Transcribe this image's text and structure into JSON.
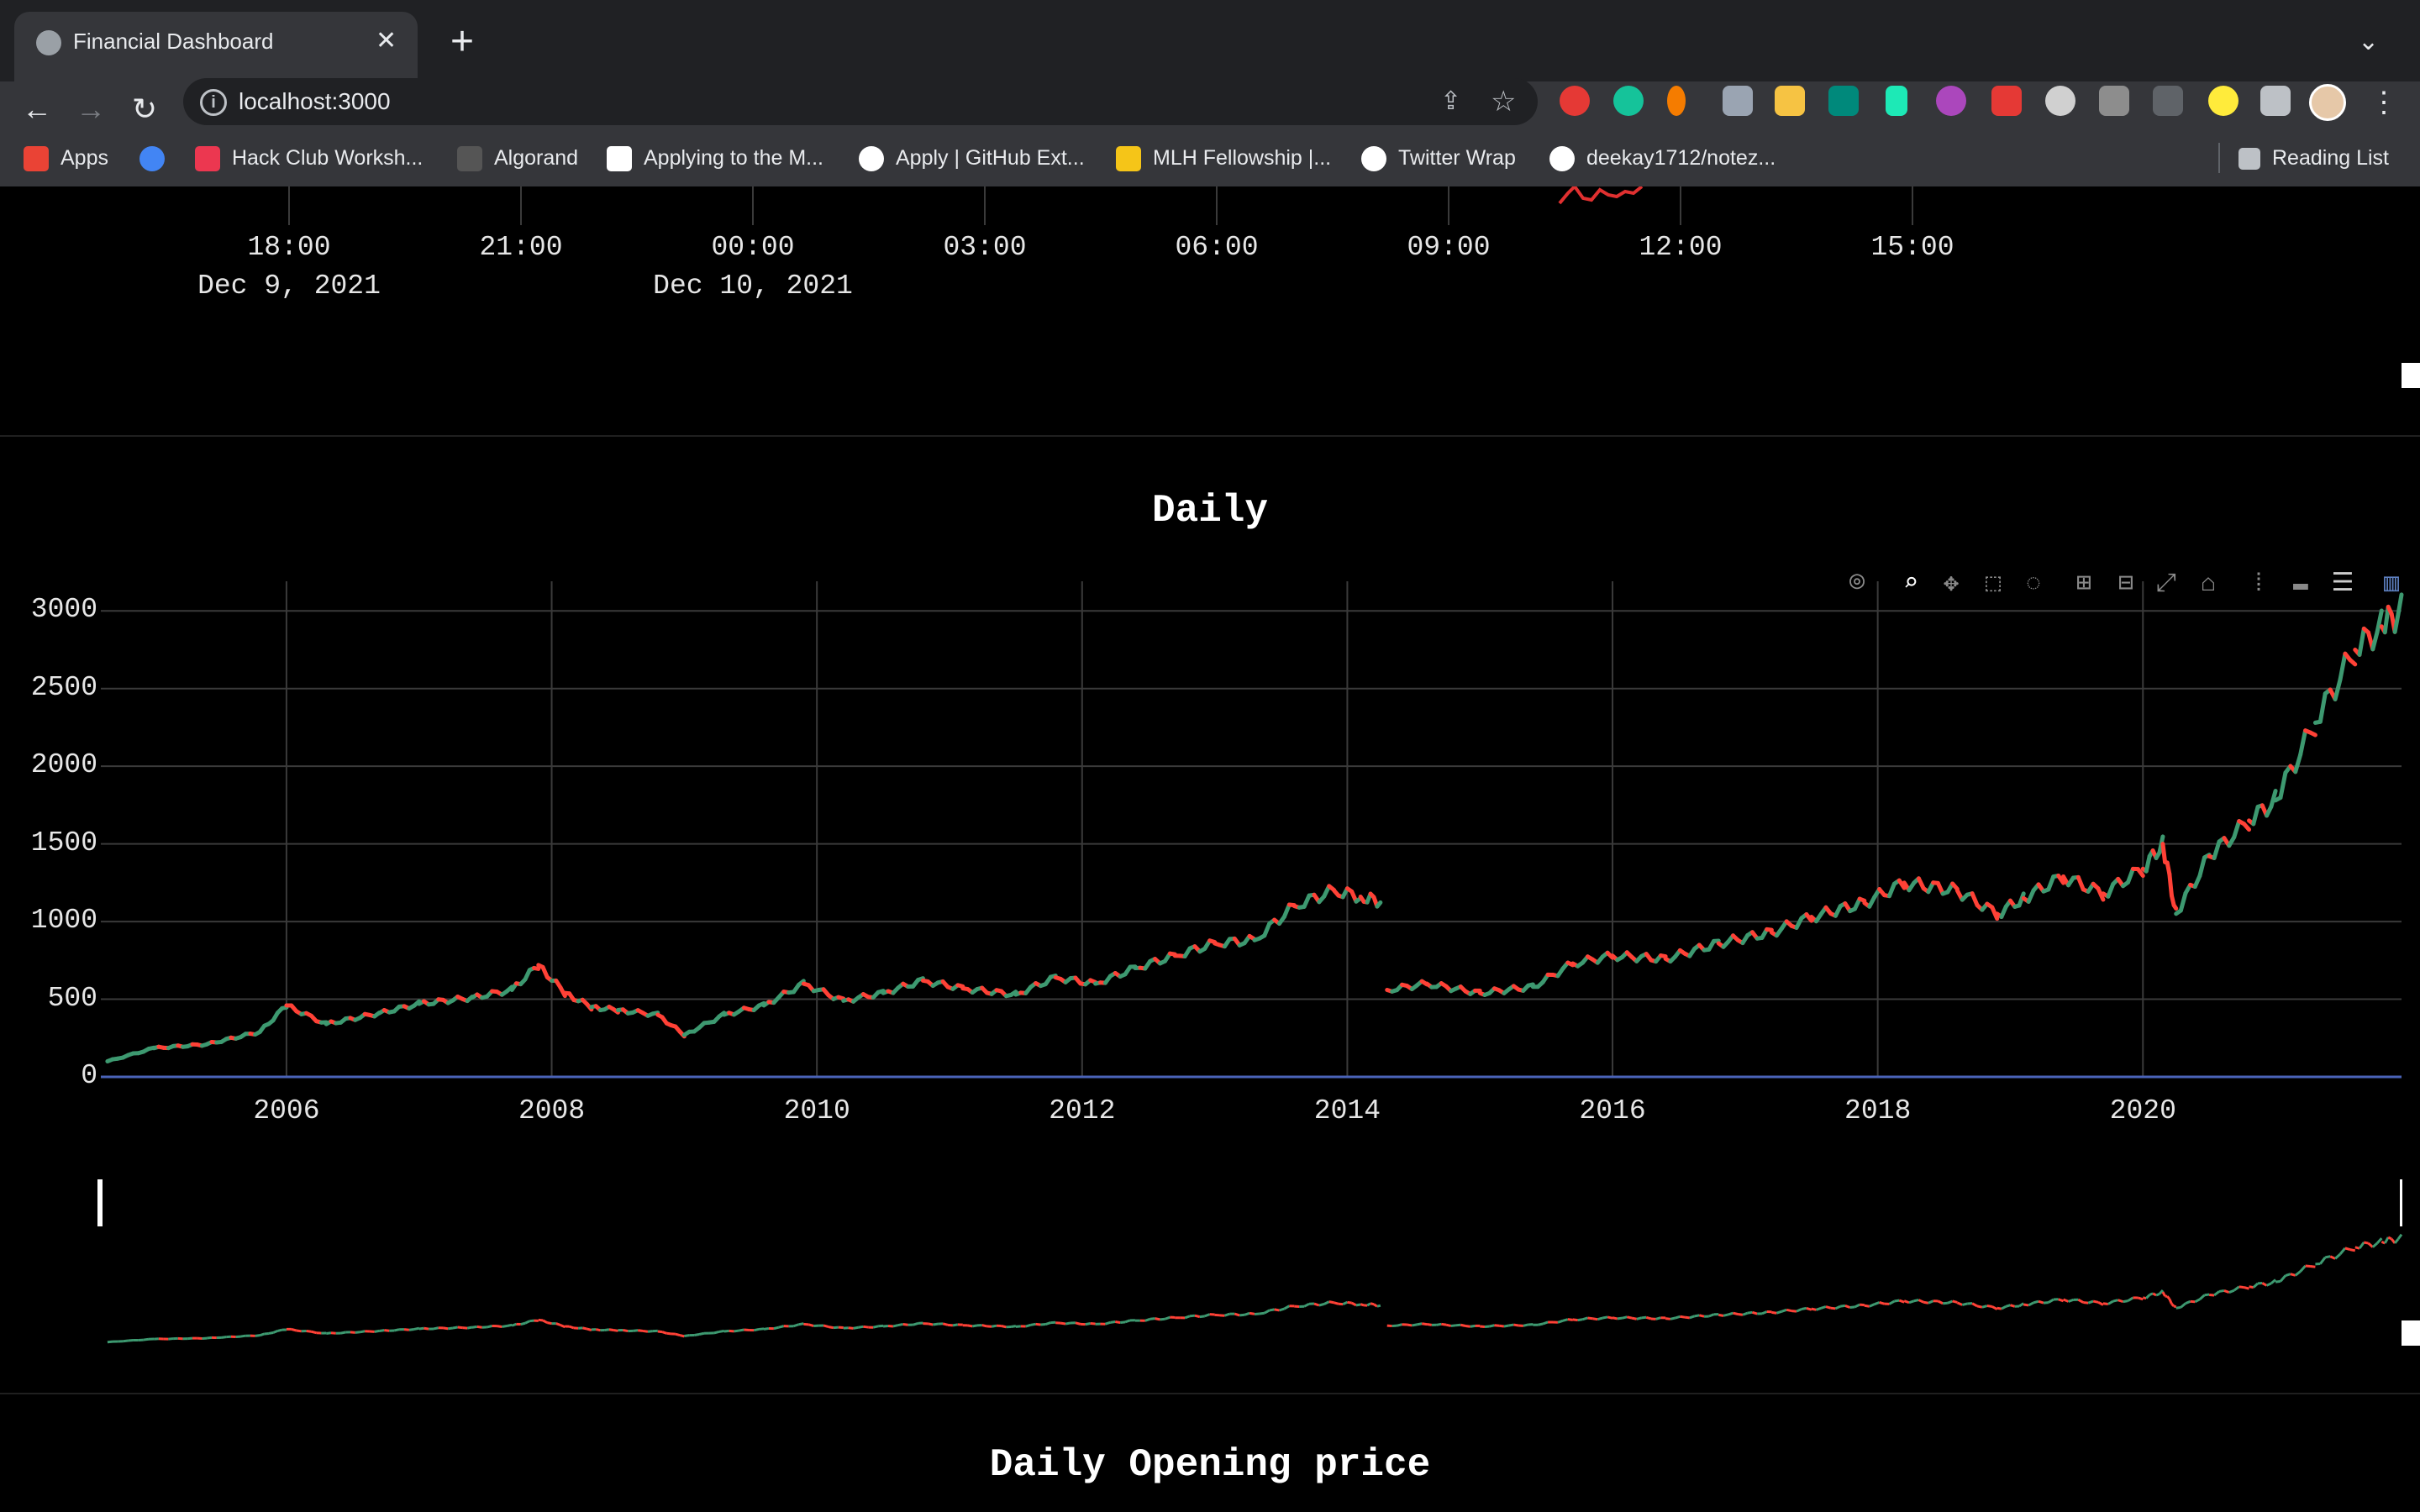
{
  "browser": {
    "tab_title": "Financial Dashboard",
    "url": "localhost:3000",
    "bookmarks": [
      {
        "label": "Apps",
        "icon": "apps-grid-icon",
        "color": "#ea4335"
      },
      {
        "label": "",
        "icon": "google-cloud-icon",
        "color": "#4285f4"
      },
      {
        "label": "Hack Club Worksh...",
        "icon": "hack-club-icon",
        "color": "#ec3750"
      },
      {
        "label": "Algorand",
        "icon": "algorand-icon",
        "color": "#555555"
      },
      {
        "label": "Applying to the M...",
        "icon": "dev-icon",
        "color": "#ffffff"
      },
      {
        "label": "Apply | GitHub Ext...",
        "icon": "github-icon",
        "color": "#ffffff"
      },
      {
        "label": "MLH Fellowship |...",
        "icon": "mlh-icon",
        "color": "#f5c518"
      },
      {
        "label": "Twitter Wrap",
        "icon": "triangle-icon",
        "color": "#ffffff"
      },
      {
        "label": "deekay1712/notez...",
        "icon": "github-icon",
        "color": "#ffffff"
      }
    ],
    "reading_list": "Reading List"
  },
  "intraday": {
    "time_ticks": [
      "18:00",
      "21:00",
      "00:00",
      "03:00",
      "06:00",
      "09:00",
      "12:00",
      "15:00"
    ],
    "date_labels": [
      "Dec 9, 2021",
      "Dec 10, 2021"
    ]
  },
  "daily": {
    "title": "Daily",
    "next_title": "Daily Opening price",
    "chart_data": {
      "type": "candlestick",
      "title": "Daily",
      "x_ticks": [
        "2006",
        "2008",
        "2010",
        "2012",
        "2014",
        "2016",
        "2018",
        "2020"
      ],
      "y_ticks": [
        "0",
        "500",
        "1000",
        "1500",
        "2000",
        "2500",
        "3000"
      ],
      "ylim": [
        0,
        3050
      ],
      "xlim": [
        2004.6,
        2021.95
      ],
      "rangeslider": true,
      "grid": true,
      "increasing_color": "#3d9970",
      "decreasing_color": "#ff4136",
      "x": [
        2004.65,
        2005.0,
        2005.4,
        2005.8,
        2006.0,
        2006.3,
        2006.7,
        2007.0,
        2007.4,
        2007.7,
        2007.9,
        2008.1,
        2008.3,
        2008.5,
        2008.8,
        2009.0,
        2009.3,
        2009.6,
        2009.9,
        2010.2,
        2010.5,
        2010.8,
        2011.1,
        2011.5,
        2011.8,
        2012.1,
        2012.4,
        2012.7,
        2013.0,
        2013.3,
        2013.6,
        2013.9,
        2014.1,
        2014.25,
        2014.3,
        2014.6,
        2015.0,
        2015.4,
        2015.7,
        2016.0,
        2016.4,
        2016.8,
        2017.2,
        2017.5,
        2017.9,
        2018.2,
        2018.6,
        2018.9,
        2019.1,
        2019.4,
        2019.7,
        2020.0,
        2020.15,
        2020.25,
        2020.5,
        2020.8,
        2021.0,
        2021.3,
        2021.6,
        2021.8,
        2021.95
      ],
      "values": [
        100,
        185,
        210,
        290,
        460,
        340,
        410,
        470,
        510,
        560,
        720,
        540,
        450,
        430,
        400,
        270,
        400,
        460,
        600,
        490,
        540,
        620,
        570,
        530,
        640,
        600,
        700,
        780,
        860,
        880,
        1100,
        1200,
        1160,
        1130,
        560,
        600,
        540,
        580,
        730,
        780,
        760,
        860,
        930,
        1030,
        1120,
        1250,
        1200,
        1050,
        1150,
        1290,
        1180,
        1340,
        1500,
        1050,
        1420,
        1650,
        1780,
        2280,
        2750,
        2900,
        3000
      ]
    }
  }
}
